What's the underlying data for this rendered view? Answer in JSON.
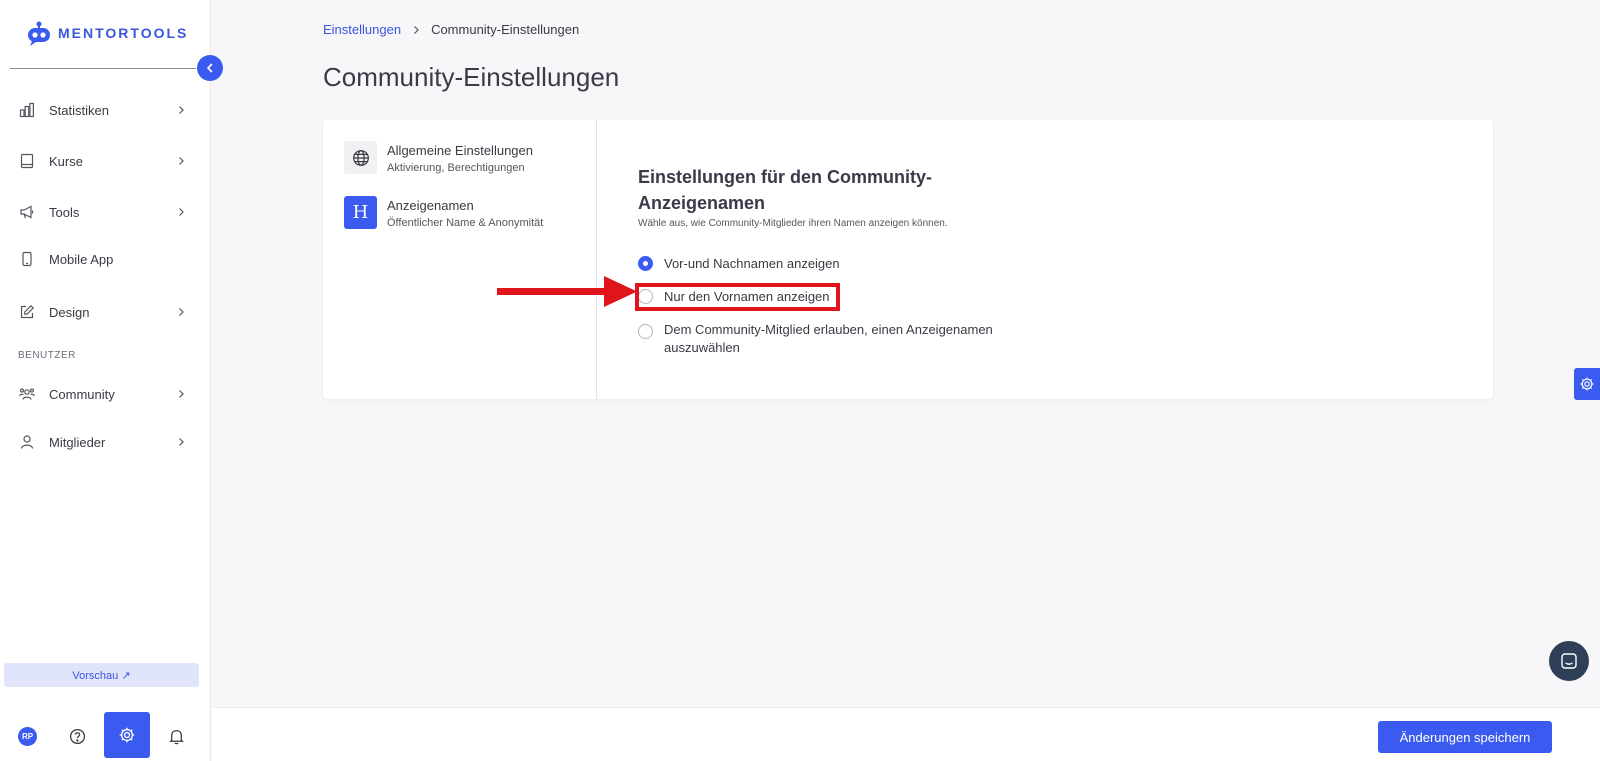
{
  "app": {
    "brand": "MENTORTOOLS"
  },
  "sidebar": {
    "items": [
      {
        "label": "Statistiken",
        "icon": "bar-chart-icon"
      },
      {
        "label": "Kurse",
        "icon": "book-icon"
      },
      {
        "label": "Tools",
        "icon": "megaphone-icon"
      },
      {
        "label": "Mobile App",
        "icon": "smartphone-icon"
      },
      {
        "label": "Design",
        "icon": "edit-icon"
      },
      {
        "label": "Community",
        "icon": "users-icon"
      },
      {
        "label": "Mitglieder",
        "icon": "user-icon"
      }
    ],
    "section_label": "BENUTZER",
    "preview_label": "Vorschau ↗",
    "avatar_initials": "RP"
  },
  "breadcrumb": {
    "parent": "Einstellungen",
    "current": "Community-Einstellungen"
  },
  "page": {
    "title": "Community-Einstellungen"
  },
  "settings_menu": [
    {
      "title": "Allgemeine Einstellungen",
      "subtitle": "Aktivierung, Berechtigungen",
      "icon": "globe-icon"
    },
    {
      "title": "Anzeigenamen",
      "subtitle": "Öffentlicher Name & Anonymität",
      "icon": "heading-icon",
      "glyph": "H"
    }
  ],
  "display_names": {
    "title": "Einstellungen für den Community-Anzeigenamen",
    "subtitle": "Wähle aus, wie Community-Mitglieder ihren Namen anzeigen können.",
    "options": [
      {
        "label": "Vor-und Nachnamen anzeigen",
        "checked": true
      },
      {
        "label": "Nur den Vornamen anzeigen",
        "checked": false
      },
      {
        "label": "Dem Community-Mitglied erlauben, einen Anzeigenamen auszuwählen",
        "checked": false
      }
    ]
  },
  "footer": {
    "save_label": "Änderungen speichern"
  },
  "colors": {
    "accent": "#3b5bf0",
    "highlight": "#e0141b",
    "chat": "#2f3f57"
  }
}
